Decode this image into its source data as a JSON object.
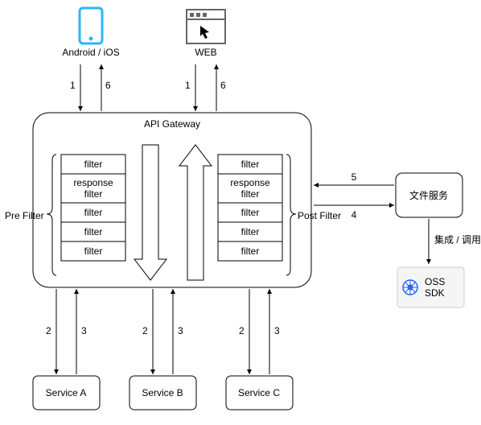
{
  "clients": {
    "mobile_label": "Android / iOS",
    "web_label": "WEB"
  },
  "gateway": {
    "title": "API Gateway",
    "pre_label": "Pre Filter",
    "post_label": "Post Filter",
    "pre_filters": [
      "filter",
      "response filter",
      "filter",
      "filter",
      "filter"
    ],
    "post_filters": [
      "filter",
      "response filter",
      "filter",
      "filter",
      "filter"
    ]
  },
  "services": {
    "a": "Service A",
    "b": "Service B",
    "c": "Service C"
  },
  "file_service": {
    "title": "文件服务",
    "integrate_label": "集成 / 调用"
  },
  "oss": {
    "line1": "OSS",
    "line2": "SDK"
  },
  "edge_labels": {
    "mobile_down": "1",
    "mobile_up": "6",
    "web_down": "1",
    "web_up": "6",
    "svc_a_down": "2",
    "svc_a_up": "3",
    "svc_b_down": "2",
    "svc_b_up": "3",
    "svc_c_down": "2",
    "svc_c_up": "3",
    "gateway_file_up": "5",
    "gateway_file_down": "4"
  }
}
